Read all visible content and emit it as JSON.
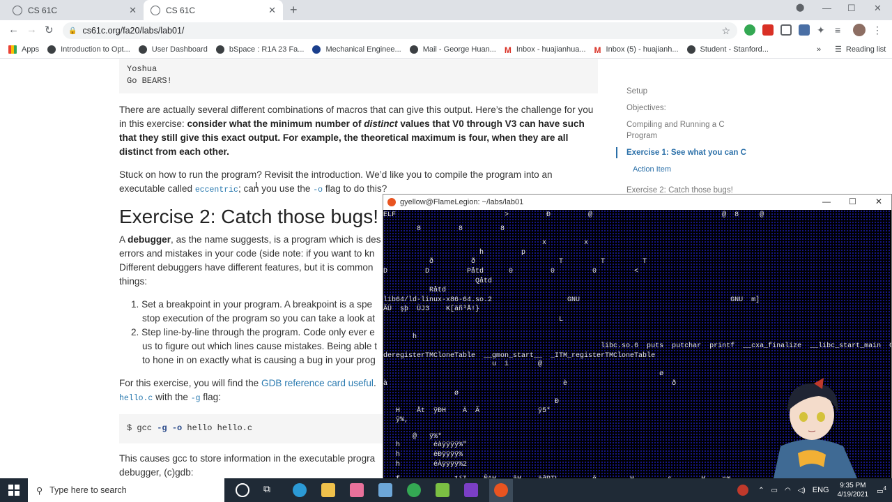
{
  "browser": {
    "tabs": [
      {
        "title": "CS 61C"
      },
      {
        "title": "CS 61C"
      }
    ],
    "url": "cs61c.org/fa20/labs/lab01/",
    "bookmarks": [
      "Apps",
      "Introduction to Opt...",
      "User Dashboard",
      "bSpace : R1A 23 Fa...",
      "Mechanical Enginee...",
      "Mail - George Huan...",
      "Inbox - huajianhua...",
      "Inbox (5) - huajianh...",
      "Student - Stanford..."
    ],
    "reading_list": "Reading list",
    "more": "»"
  },
  "page": {
    "code_output": [
      "Yoshua",
      "Go BEARS!"
    ],
    "para1_a": "There are actually several different combinations of macros that can give this output. Here’s the challenge for you in this exercise: ",
    "para1_b1": "consider what the minimum number of ",
    "para1_b2": "distinct",
    "para1_b3": " values that V0 through V3 can have such that they still give this exact output. For example, the theoretical maximum is four, when they are all distinct from each other.",
    "para2_a": "Stuck on how to run the program? Revisit the introduction. We’d like you to compile the program into an executable called ",
    "para2_code": "eccentric",
    "para2_b": "; can you use the ",
    "para2_flag": "-o",
    "para2_c": " flag to do this?",
    "heading": "Exercise 2: Catch those bugs!",
    "para3_a": "A ",
    "para3_b": "debugger",
    "para3_c": ", as the name suggests, is a program which is des",
    "para3_line2": "errors and mistakes in your code (side note: if you want to kn",
    "para3_line3": "Different debuggers have different features, but it is common",
    "para3_line4": "things:",
    "li1": [
      "1. Set a breakpoint in your program. A breakpoint is a spe",
      "stop execution of the program so you can take a look at"
    ],
    "li2": [
      "2. Step line-by-line through the program. Code only ever e",
      "us to figure out which lines cause mistakes. Being able t",
      "to hone in on exactly what is causing a bug in your prog"
    ],
    "para4_a": "For this exercise, you will find the ",
    "para4_link": "GDB reference card useful",
    "para4_b": ".",
    "para4_code": "hello.c",
    "para4_c": " with the ",
    "para4_flag": "-g",
    "para4_d": " flag:",
    "cmd_a": "$ gcc ",
    "cmd_b": "-g -o",
    "cmd_c": " hello hello.c",
    "para5_a": "This causes gcc to store information in the executable progra",
    "para5_b": "debugger, (c)gdb:"
  },
  "toc": {
    "items": [
      "Setup",
      "Objectives:",
      "Compiling and Running a C Program"
    ],
    "active": "Exercise 1: See what you can C",
    "sub": "Action Item",
    "next": "Exercise 2: Catch those bugs!"
  },
  "terminal": {
    "title": "gyellow@FlameLegion: ~/labs/lab01",
    "lines": [
      "ELF                          >         Ð         @                               @  8     @",
      "        8         8         8",
      "                                      x         x",
      "                       h         p",
      "           ð         ð                    T         T         T",
      "D         D         Påtd      0         0         0         <",
      "                      Qåtd",
      "           Råtd",
      "lib64/ld-linux-x86-64.so.2                  GNU                                    GNU  m]",
      "ÃÜ  şþ  ÜJ3    K[äñ³Å!}",
      "                                          L",
      "       h",
      "                                                    libc.so.6  puts  putchar  printf  __cxa_finalize  __libc_start_main  GLIBC_2.2.5  _ITM_",
      "deregisterTMCloneTable  __gmon_start__  _ITM_registerTMCloneTable",
      "                          u  i       @",
      "                                                                  ø",
      "à                                          è                         ð",
      "                 ø",
      "                                         Ð",
      "   H    Åt  ÿÐH    Ä  Ã              ÿ5*",
      "   ÿ%,",
      "       @   ÿ%*",
      "   h        éàÿÿÿÿ%\"",
      "   h        éÐÿÿÿÿ%",
      "   h        éÀÿÿÿÿ%2",
      "   f             1íI    Ñ^H    âH    äðPTL        ê        H        s       H    =æ",
      "   UH"
    ]
  },
  "taskbar": {
    "search_placeholder": "Type here to search",
    "time": "9:35 PM",
    "date": "4/19/2021",
    "lang": "ENG",
    "notif_count": "4"
  }
}
